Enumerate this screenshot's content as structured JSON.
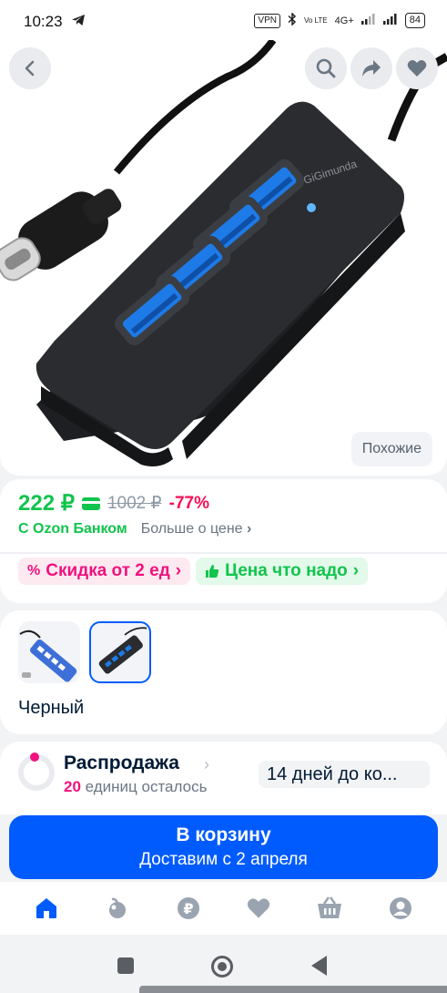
{
  "status_bar": {
    "time": "10:23",
    "vpn": "VPN",
    "volte": "Vo LTE",
    "network": "4G+",
    "battery": "84"
  },
  "gallery": {
    "back_icon": "back-arrow-icon",
    "actions": [
      "search-icon",
      "share-icon",
      "heart-icon"
    ],
    "similar_label": "Похожие",
    "brand_text": "GiGimunda"
  },
  "price": {
    "current": "222 ₽",
    "old": "1002 ₽",
    "discount": "-77%",
    "bank_label": "С Ozon Банком",
    "more_label": "Больше о цене",
    "more_chevron": "›"
  },
  "chips": [
    {
      "icon": "%",
      "label": "Скидка от 2 ед",
      "chevron": "›",
      "color": "#f1117e"
    },
    {
      "icon": "thumbs-up-icon",
      "label": "Цена что надо",
      "chevron": "›",
      "color": "#10c44c"
    }
  ],
  "variants": {
    "selected_label": "Черный",
    "options": [
      "blue",
      "black"
    ]
  },
  "sale": {
    "title": "Распродажа",
    "chevron": "›",
    "count": "20",
    "remaining_text": "единиц осталось",
    "days_text": "14 дней до ко..."
  },
  "cart_button": {
    "title": "В корзину",
    "subtitle": "Доставим с 2 апреля"
  },
  "tab_bar": [
    "home-icon",
    "fresh-icon",
    "ruble-icon",
    "favorites-icon",
    "cart-icon",
    "profile-icon"
  ],
  "colors": {
    "accent": "#005bff",
    "price_green": "#10c44c",
    "discount_red": "#f91155",
    "promo_pink": "#f1117e"
  }
}
